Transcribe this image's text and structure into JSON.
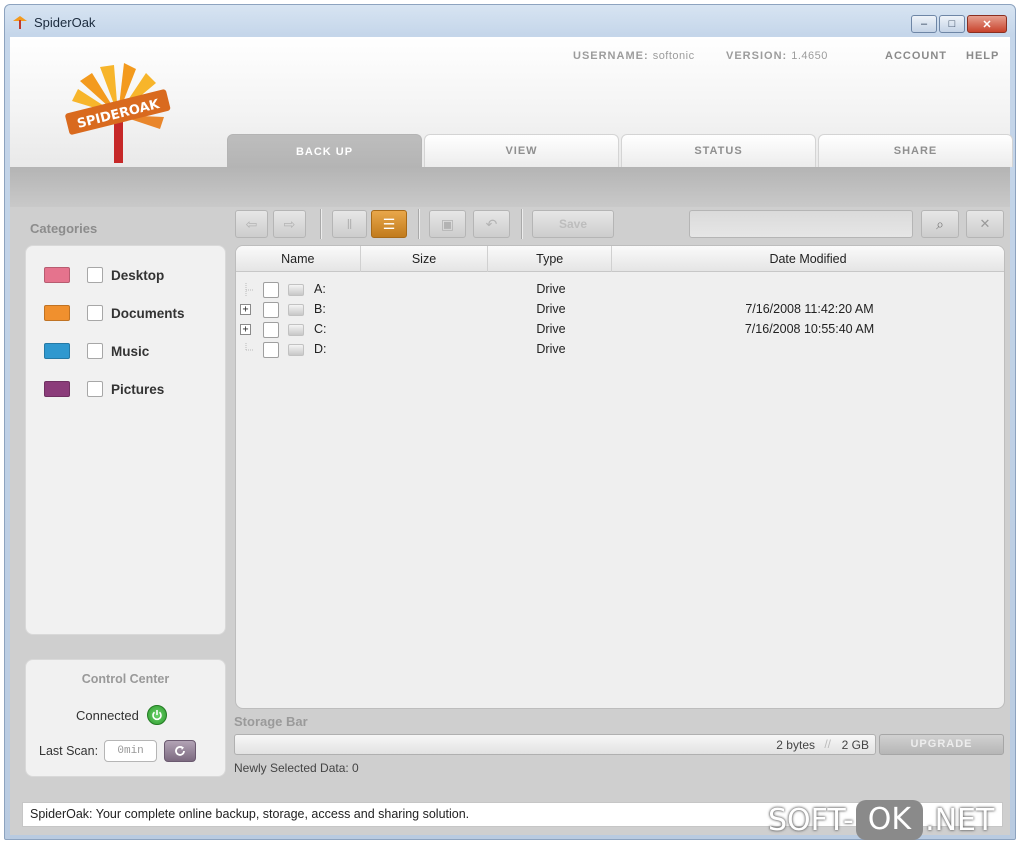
{
  "window": {
    "title": "SpiderOak",
    "minimize_glyph": "–",
    "maximize_glyph": "□",
    "close_glyph": "✕"
  },
  "header": {
    "logo_text": "SPIDEROAK",
    "username_label": "USERNAME:",
    "username_value": "softonic",
    "version_label": "VERSION:",
    "version_value": "1.4650",
    "account_link": "ACCOUNT",
    "help_link": "HELP"
  },
  "tabs": [
    {
      "label": "BACK UP",
      "active": true
    },
    {
      "label": "VIEW",
      "active": false
    },
    {
      "label": "STATUS",
      "active": false
    },
    {
      "label": "SHARE",
      "active": false
    }
  ],
  "categories": {
    "title": "Categories",
    "items": [
      {
        "label": "Desktop",
        "color": "#e5738d"
      },
      {
        "label": "Documents",
        "color": "#f0902e"
      },
      {
        "label": "Music",
        "color": "#2f98cf"
      },
      {
        "label": "Pictures",
        "color": "#8b3c7a"
      }
    ]
  },
  "control_center": {
    "title": "Control Center",
    "status": "Connected",
    "last_scan_label": "Last Scan:",
    "last_scan_value": "0min"
  },
  "toolbar": {
    "back_icon": "⇦",
    "forward_icon": "⇨",
    "columns_icon": "‖",
    "tree_icon": "☰",
    "window_icon": "▣",
    "undo_icon": "↶",
    "save_label": "Save",
    "search_icon": "⌕",
    "clear_icon": "✕"
  },
  "filelist": {
    "columns": [
      "Name",
      "Size",
      "Type",
      "Date Modified"
    ],
    "rows": [
      {
        "name": "A:",
        "size": "",
        "type": "Drive",
        "date": "",
        "expandable": false
      },
      {
        "name": "B:",
        "size": "",
        "type": "Drive",
        "date": "7/16/2008 11:42:20 AM",
        "expandable": true
      },
      {
        "name": "C:",
        "size": "",
        "type": "Drive",
        "date": "7/16/2008 10:55:40 AM",
        "expandable": true
      },
      {
        "name": "D:",
        "size": "",
        "type": "Drive",
        "date": "",
        "expandable": false
      }
    ]
  },
  "storage": {
    "title": "Storage Bar",
    "used": "2 bytes",
    "total": "2 GB",
    "upgrade_label": "UPGRADE",
    "newly_selected": "Newly Selected Data: 0"
  },
  "statusbar": {
    "text": "SpiderOak: Your complete online backup, storage, access and sharing solution."
  },
  "watermark": {
    "part1": "SOFT-",
    "part2": "OK",
    "part3": ".NET"
  }
}
